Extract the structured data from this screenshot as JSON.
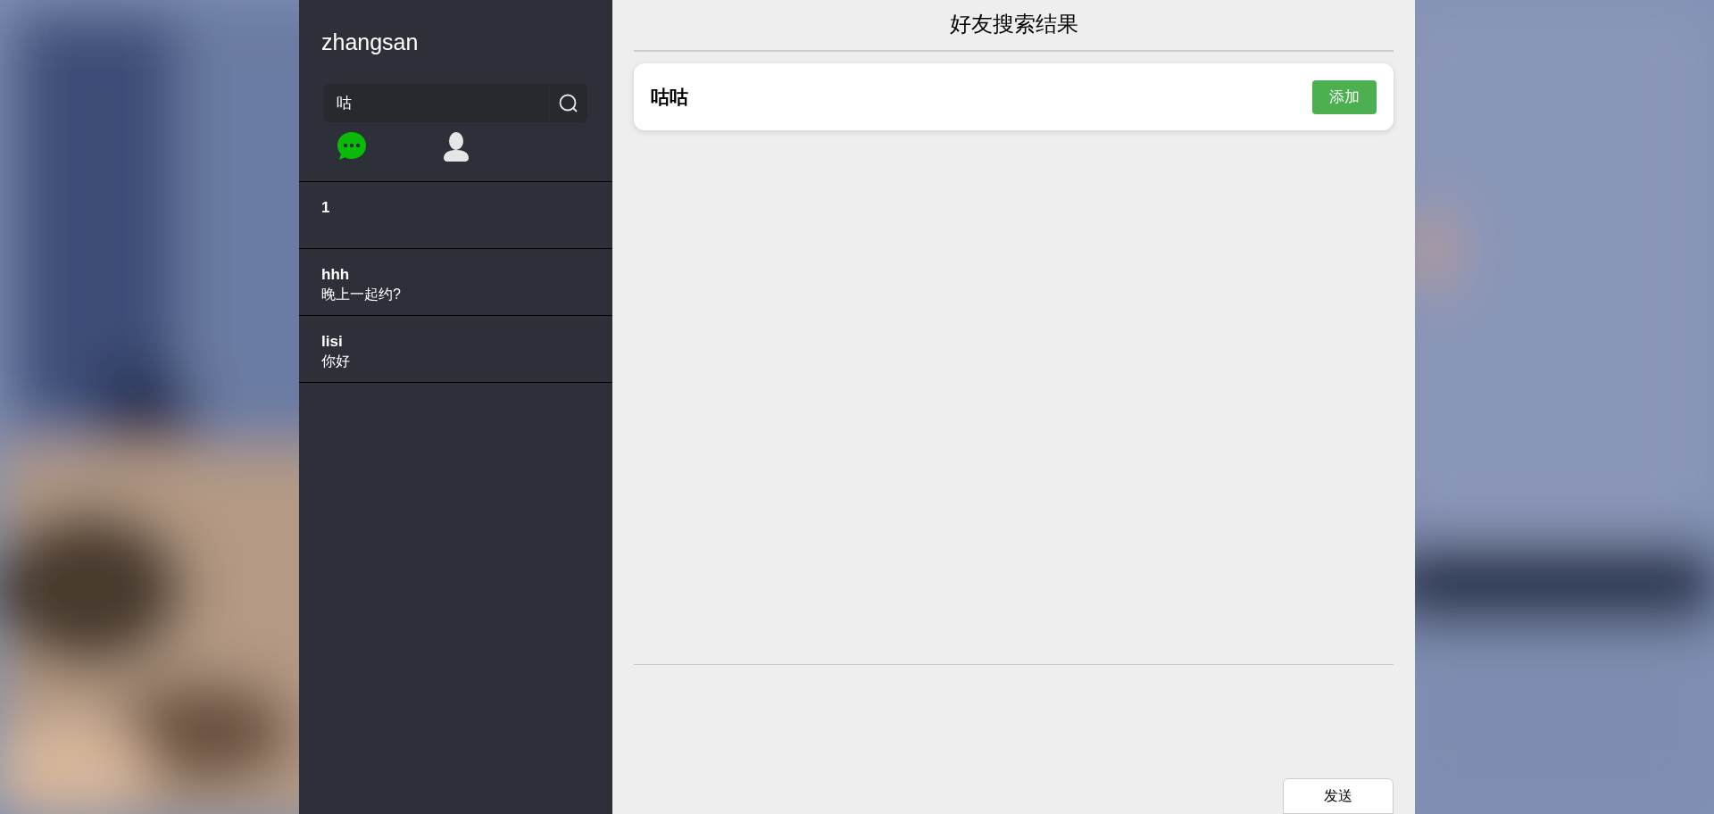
{
  "sidebar": {
    "username": "zhangsan",
    "search": {
      "value": "咕"
    },
    "tabs": [
      {
        "kind": "chat",
        "selected": true
      },
      {
        "kind": "contacts",
        "selected": false
      }
    ],
    "conversations": [
      {
        "name": "1"
      },
      {
        "name": "hhh",
        "message": "晚上一起约?"
      },
      {
        "name": "lisi",
        "message": "你好"
      }
    ]
  },
  "main": {
    "title": "好友搜索结果",
    "results": [
      {
        "name": "咕咕",
        "action": "添加"
      }
    ],
    "send_button": "发送"
  }
}
